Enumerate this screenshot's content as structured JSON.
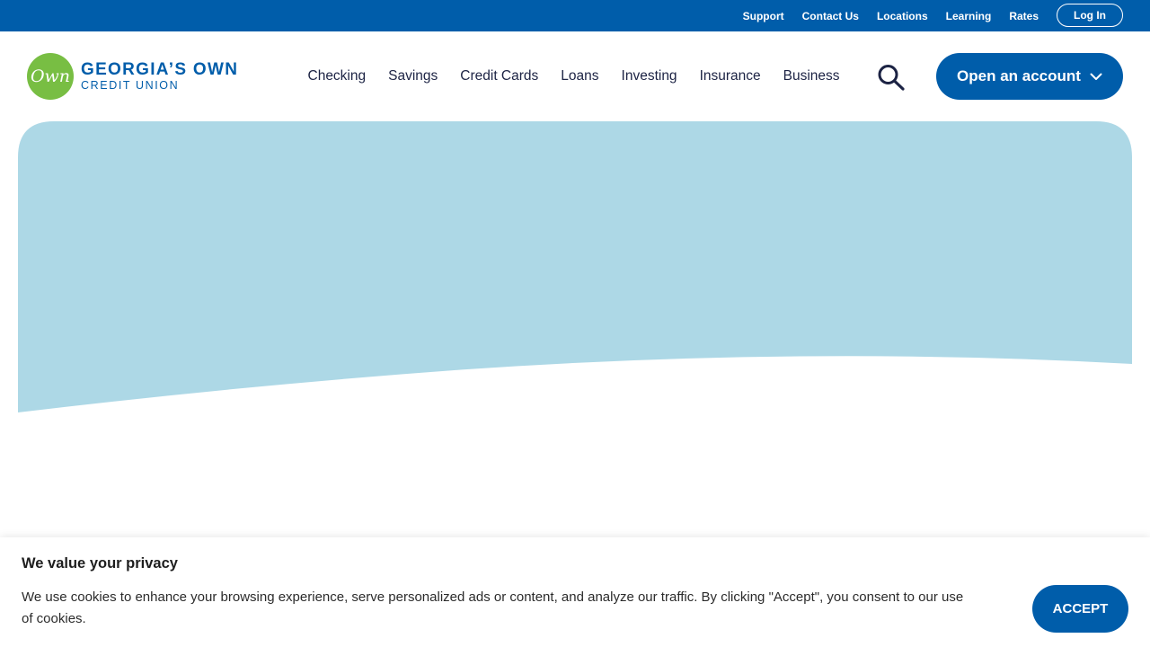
{
  "utility_nav": {
    "links": [
      "Support",
      "Contact Us",
      "Locations",
      "Learning",
      "Rates"
    ],
    "login_label": "Log In"
  },
  "brand": {
    "logo_mark": "Own",
    "name_line1": "GEORGIA’S OWN",
    "name_line2": "CREDIT UNION"
  },
  "main_nav": {
    "items": [
      "Checking",
      "Savings",
      "Credit Cards",
      "Loans",
      "Investing",
      "Insurance",
      "Business"
    ],
    "search_icon": "search-icon",
    "open_account_label": "Open an account"
  },
  "hero": {
    "background_color": "#add8e6"
  },
  "cookie_banner": {
    "title": "We value your privacy",
    "text": "We use cookies to enhance your browsing experience, serve personalized ads or content, and analyze our traffic. By clicking \"Accept\", you consent to our use of cookies.",
    "accept_label": "ACCEPT"
  },
  "colors": {
    "brand_blue": "#005daa",
    "logo_green": "#78be43",
    "nav_text": "#1c2344"
  }
}
